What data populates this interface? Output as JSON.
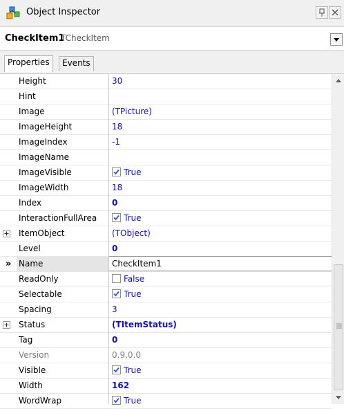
{
  "window": {
    "title": "Object Inspector"
  },
  "object": {
    "name": "CheckItem1",
    "type": "TCheckItem"
  },
  "tabs": [
    {
      "label": "Properties"
    },
    {
      "label": "Events"
    }
  ],
  "properties": [
    {
      "name": "Height",
      "value": "30",
      "style": "normal"
    },
    {
      "name": "Hint",
      "value": "",
      "style": "normal"
    },
    {
      "name": "Image",
      "value": "(TPicture)",
      "style": "normal"
    },
    {
      "name": "ImageHeight",
      "value": "18",
      "style": "normal"
    },
    {
      "name": "ImageIndex",
      "value": "-1",
      "style": "normal"
    },
    {
      "name": "ImageName",
      "value": "",
      "style": "normal"
    },
    {
      "name": "ImageVisible",
      "value": "True",
      "style": "normal",
      "checkbox": true,
      "checked": true
    },
    {
      "name": "ImageWidth",
      "value": "18",
      "style": "normal"
    },
    {
      "name": "Index",
      "value": "0",
      "style": "bold"
    },
    {
      "name": "InteractionFullArea",
      "value": "True",
      "style": "normal",
      "checkbox": true,
      "checked": true
    },
    {
      "name": "ItemObject",
      "value": "(TObject)",
      "style": "normal",
      "expandable": true
    },
    {
      "name": "Level",
      "value": "0",
      "style": "bold"
    },
    {
      "name": "Name",
      "value": "CheckItem1",
      "style": "plain",
      "selected": true
    },
    {
      "name": "ReadOnly",
      "value": "False",
      "style": "normal",
      "checkbox": true,
      "checked": false
    },
    {
      "name": "Selectable",
      "value": "True",
      "style": "normal",
      "checkbox": true,
      "checked": true
    },
    {
      "name": "Spacing",
      "value": "3",
      "style": "normal"
    },
    {
      "name": "Status",
      "value": "(TItemStatus)",
      "style": "bold",
      "expandable": true
    },
    {
      "name": "Tag",
      "value": "0",
      "style": "bold"
    },
    {
      "name": "Version",
      "value": "0.9.0.0",
      "style": "disabled"
    },
    {
      "name": "Visible",
      "value": "True",
      "style": "normal",
      "checkbox": true,
      "checked": true
    },
    {
      "name": "Width",
      "value": "162",
      "style": "bold"
    },
    {
      "name": "WordWrap",
      "value": "True",
      "style": "normal",
      "checkbox": true,
      "checked": true
    }
  ],
  "selected_marker": "»",
  "colors": {
    "value_text": "#1212a6",
    "checkmark": "#2b57c5",
    "selected_name_bg": "#e5e5e5"
  }
}
